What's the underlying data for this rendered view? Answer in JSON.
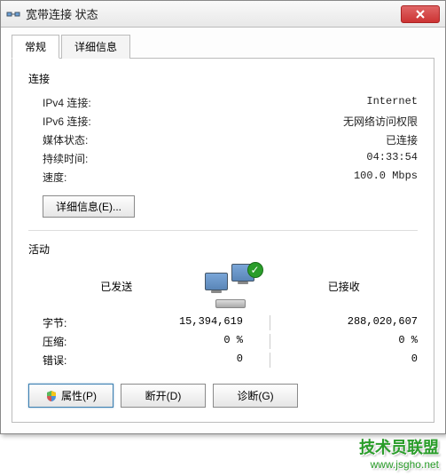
{
  "titlebar": {
    "title": "宽带连接 状态"
  },
  "tabs": {
    "general": "常规",
    "details": "详细信息"
  },
  "connection": {
    "title": "连接",
    "ipv4_label": "IPv4 连接:",
    "ipv4_value": "Internet",
    "ipv6_label": "IPv6 连接:",
    "ipv6_value": "无网络访问权限",
    "media_label": "媒体状态:",
    "media_value": "已连接",
    "duration_label": "持续时间:",
    "duration_value": "04:33:54",
    "speed_label": "速度:",
    "speed_value": "100.0 Mbps",
    "details_btn": "详细信息(E)..."
  },
  "activity": {
    "title": "活动",
    "sent_label": "已发送",
    "recv_label": "已接收",
    "bytes_label": "字节:",
    "bytes_sent": "15,394,619",
    "bytes_recv": "288,020,607",
    "compress_label": "压缩:",
    "compress_sent": "0 %",
    "compress_recv": "0 %",
    "errors_label": "错误:",
    "errors_sent": "0",
    "errors_recv": "0"
  },
  "buttons": {
    "properties": "属性(P)",
    "disconnect": "断开(D)",
    "diagnose": "诊断(G)"
  },
  "watermark": {
    "text": "技术员联盟",
    "url": "www.jsgho.net"
  }
}
